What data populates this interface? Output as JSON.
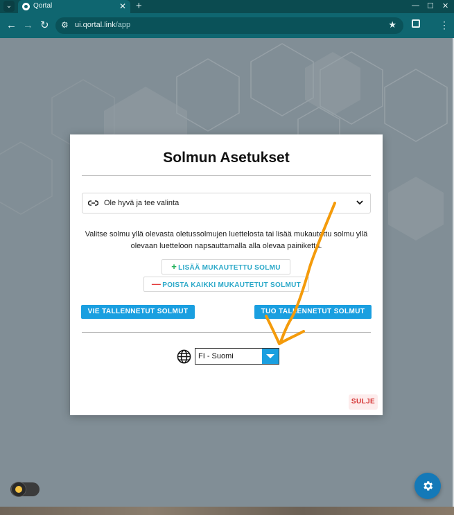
{
  "browser": {
    "tab_title": "Qortal",
    "tab_close": "✕",
    "new_tab": "+",
    "tab_list": "⌄",
    "url_host": "ui.qortal.link",
    "url_path": "/app",
    "back": "←",
    "forward": "→",
    "reload": "↻",
    "bookmark": "★",
    "menu": "⋮",
    "minimize": "—",
    "maximize": "☐",
    "close": "✕"
  },
  "dialog": {
    "title": "Solmun Asetukset",
    "node_select_placeholder": "Ole hyvä ja tee valinta",
    "help_text": "Valitse solmu yllä olevasta oletussolmujen luettelosta tai lisää mukautettu solmu yllä olevaan luetteloon napsauttamalla alla olevaa painiketta.",
    "add_button": "LISÄÄ MUKAUTETTU SOLMU",
    "remove_all_button": "POISTA KAIKKI MUKAUTETUT SOLMUT",
    "export_button": "VIE TALLENNETUT SOLMUT",
    "import_button": "TUO TALLENNETUT SOLMUT",
    "language_value": "FI - Suomi",
    "close_button": "SULJE"
  },
  "colors": {
    "accent": "#1a9fe0",
    "browser_frame": "#0f6670",
    "annotation_arrow": "#f49b0b",
    "close_text": "#d32f2f"
  },
  "icons": {
    "node_select": "link-icon",
    "language": "globe-icon",
    "fab": "gear-icon",
    "theme": "sun-icon"
  }
}
